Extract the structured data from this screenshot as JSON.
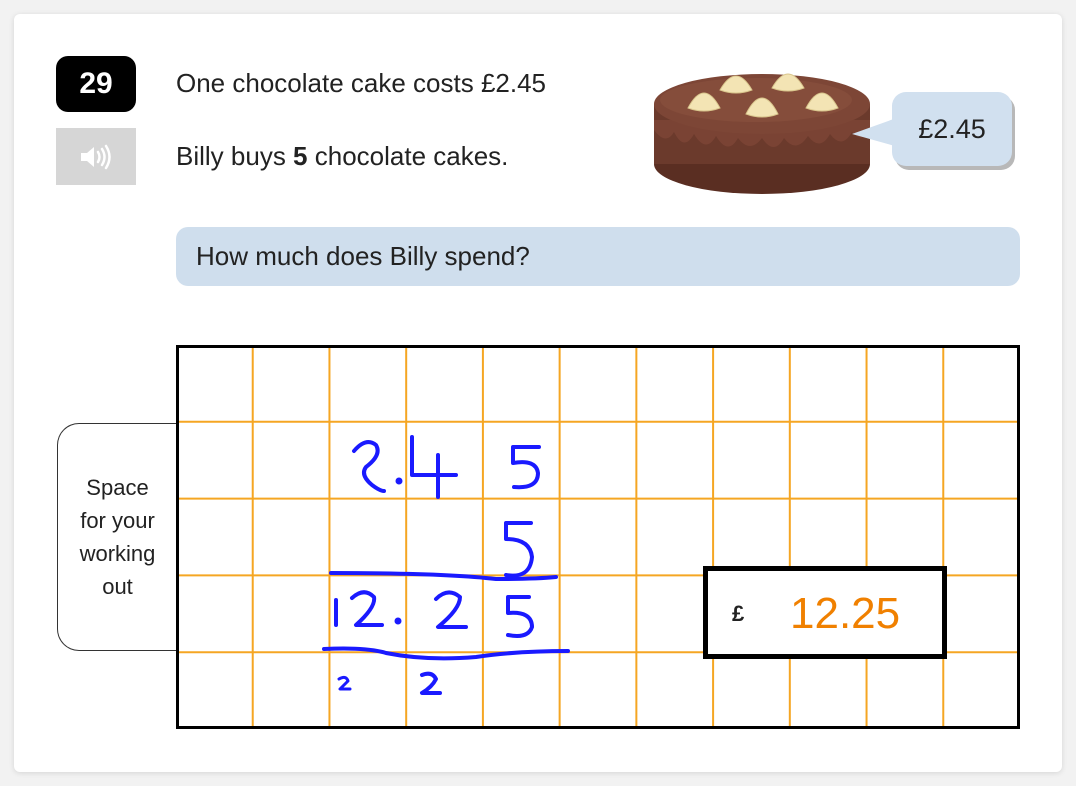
{
  "question": {
    "number": "29",
    "line1": "One chocolate cake costs £2.45",
    "line2_prefix": "Billy buys ",
    "line2_bold": "5",
    "line2_suffix": " chocolate cakes.",
    "prompt": "How much does Billy spend?"
  },
  "audio_button": {
    "icon": "speaker-icon"
  },
  "image": {
    "subject": "chocolate-cake",
    "price_bubble": "£2.45"
  },
  "working_out": {
    "label_lines": [
      "Space",
      "for your",
      "working",
      "out"
    ],
    "grid_color": "#f5a623",
    "ink_color": "#1a1aff",
    "handwriting": {
      "row1": "2.4 5",
      "row2": "5",
      "row3": "12.25",
      "carries": [
        "2",
        "2"
      ]
    }
  },
  "answer": {
    "currency": "£",
    "value": "12.25",
    "value_color": "#f08000"
  },
  "colors": {
    "prompt_bg": "#cfdeed",
    "bubble_bg": "#d1e0ef",
    "number_badge": "#000000",
    "audio_bg": "#d6d6d6"
  }
}
